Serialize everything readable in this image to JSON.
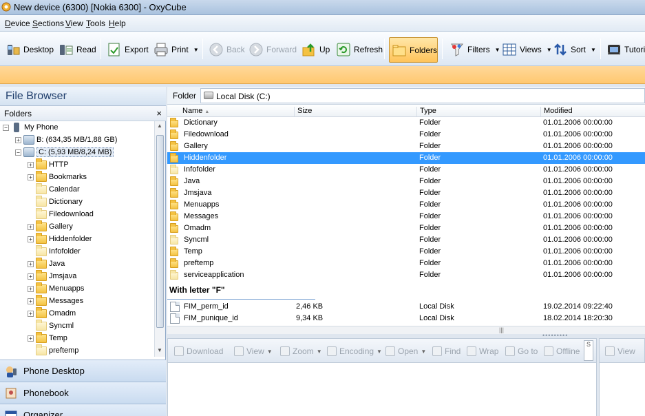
{
  "window": {
    "title": "New device (6300) [Nokia 6300] - OxyCube"
  },
  "menu": [
    "Device",
    "Sections",
    "View",
    "Tools",
    "Help"
  ],
  "toolbar": {
    "desktop": "Desktop",
    "read": "Read",
    "export": "Export",
    "print": "Print",
    "back": "Back",
    "forward": "Forward",
    "up": "Up",
    "refresh": "Refresh",
    "folders": "Folders",
    "filters": "Filters",
    "views": "Views",
    "sort": "Sort",
    "tutorial": "Tutorial"
  },
  "left": {
    "title": "File Browser",
    "folders_label": "Folders",
    "close_glyph": "×",
    "tree": {
      "root": "My Phone",
      "drive_b": "B: (634,35 MB/1,88 GB)",
      "drive_c": "C: (5,93 MB/8,24 MB)",
      "children": [
        "HTTP",
        "Bookmarks",
        "Calendar",
        "Dictionary",
        "Filedownload",
        "Gallery",
        "Hiddenfolder",
        "Infofolder",
        "Java",
        "Jmsjava",
        "Menuapps",
        "Messages",
        "Omadm",
        "Syncml",
        "Temp",
        "preftemp"
      ]
    },
    "nav": [
      "Phone Desktop",
      "Phonebook",
      "Organizer"
    ]
  },
  "path": {
    "label": "Folder",
    "value": "Local Disk (C:)"
  },
  "columns": {
    "name": "Name",
    "sort_glyph": "▲",
    "size": "Size",
    "type": "Type",
    "modified": "Modified"
  },
  "folders": [
    {
      "name": "Dictionary",
      "type": "Folder",
      "modified": "01.01.2006 00:00:00"
    },
    {
      "name": "Filedownload",
      "type": "Folder",
      "modified": "01.01.2006 00:00:00"
    },
    {
      "name": "Gallery",
      "type": "Folder",
      "modified": "01.01.2006 00:00:00"
    },
    {
      "name": "Hiddenfolder",
      "type": "Folder",
      "modified": "01.01.2006 00:00:00"
    },
    {
      "name": "Infofolder",
      "type": "Folder",
      "modified": "01.01.2006 00:00:00"
    },
    {
      "name": "Java",
      "type": "Folder",
      "modified": "01.01.2006 00:00:00"
    },
    {
      "name": "Jmsjava",
      "type": "Folder",
      "modified": "01.01.2006 00:00:00"
    },
    {
      "name": "Menuapps",
      "type": "Folder",
      "modified": "01.01.2006 00:00:00"
    },
    {
      "name": "Messages",
      "type": "Folder",
      "modified": "01.01.2006 00:00:00"
    },
    {
      "name": "Omadm",
      "type": "Folder",
      "modified": "01.01.2006 00:00:00"
    },
    {
      "name": "Syncml",
      "type": "Folder",
      "modified": "01.01.2006 00:00:00"
    },
    {
      "name": "Temp",
      "type": "Folder",
      "modified": "01.01.2006 00:00:00"
    },
    {
      "name": "preftemp",
      "type": "Folder",
      "modified": "01.01.2006 00:00:00"
    },
    {
      "name": "serviceapplication",
      "type": "Folder",
      "modified": "01.01.2006 00:00:00"
    }
  ],
  "group_header": "With letter \"F\"",
  "files": [
    {
      "name": "FIM_perm_id",
      "size": "2,46 KB",
      "type": "Local Disk",
      "modified": "19.02.2014 09:22:40"
    },
    {
      "name": "FIM_punique_id",
      "size": "9,34 KB",
      "type": "Local Disk",
      "modified": "18.02.2014 18:20:30"
    }
  ],
  "viewer": {
    "download": "Download",
    "view": "View",
    "zoom": "Zoom",
    "encoding": "Encoding",
    "open": "Open",
    "find": "Find",
    "wrap": "Wrap",
    "goto": "Go to",
    "offline": "Offline",
    "view2": "View"
  },
  "colors": {
    "accent_orange": "#ffc870",
    "selection": "#3399ff",
    "title_blue": "#1e3d6b"
  }
}
